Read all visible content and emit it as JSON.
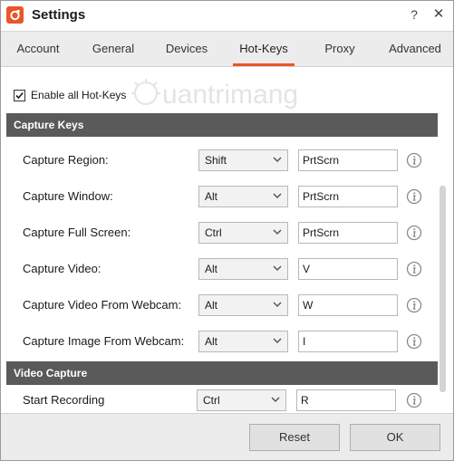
{
  "window": {
    "title": "Settings",
    "help_glyph": "?",
    "close_glyph": "✕"
  },
  "tabs": [
    {
      "label": "Account",
      "active": false
    },
    {
      "label": "General",
      "active": false
    },
    {
      "label": "Devices",
      "active": false
    },
    {
      "label": "Hot-Keys",
      "active": true
    },
    {
      "label": "Proxy",
      "active": false
    },
    {
      "label": "Advanced",
      "active": false
    }
  ],
  "enable_all": {
    "label": "Enable all Hot-Keys",
    "checked": true
  },
  "sections": {
    "capture_keys": "Capture Keys",
    "video_capture": "Video Capture"
  },
  "capture_rows": [
    {
      "label": "Capture Region:",
      "modifier": "Shift",
      "key": "PrtScrn"
    },
    {
      "label": "Capture Window:",
      "modifier": "Alt",
      "key": "PrtScrn"
    },
    {
      "label": "Capture Full Screen:",
      "modifier": "Ctrl",
      "key": "PrtScrn"
    },
    {
      "label": "Capture Video:",
      "modifier": "Alt",
      "key": "V"
    },
    {
      "label": "Capture Video From Webcam:",
      "modifier": "Alt",
      "key": "W"
    },
    {
      "label": "Capture Image From Webcam:",
      "modifier": "Alt",
      "key": "I"
    }
  ],
  "video_rows": [
    {
      "label": "Start Recording",
      "modifier": "Ctrl",
      "key": "R"
    }
  ],
  "footer": {
    "reset_label": "Reset",
    "ok_label": "OK"
  },
  "watermark": {
    "text": "uantrimang"
  },
  "colors": {
    "accent": "#e8562a",
    "section_bg": "#5a5a5a",
    "footer_bg": "#ececec"
  },
  "icons": [
    "app-logo-icon",
    "help-icon",
    "close-icon",
    "checkmark-icon",
    "chevron-down-icon",
    "info-icon"
  ]
}
